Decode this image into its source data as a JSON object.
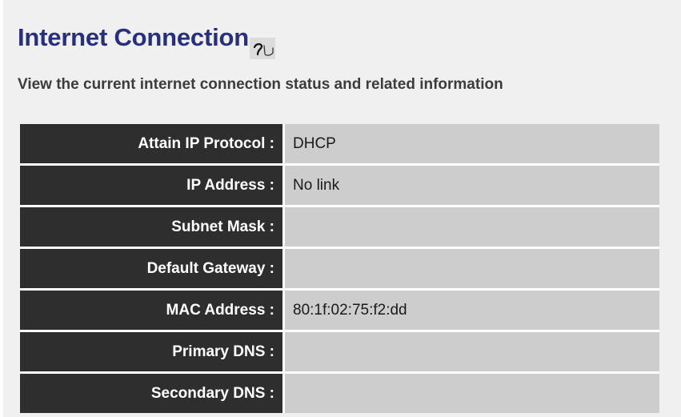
{
  "page": {
    "title": "Internet Connection",
    "description": "View the current internet connection status and related information",
    "help_icon": "help-icon"
  },
  "status_rows": [
    {
      "label": "Attain IP Protocol :",
      "value": "DHCP"
    },
    {
      "label": "IP Address :",
      "value": "No link"
    },
    {
      "label": "Subnet Mask :",
      "value": ""
    },
    {
      "label": "Default Gateway :",
      "value": ""
    },
    {
      "label": "MAC Address :",
      "value": "80:1f:02:75:f2:dd"
    },
    {
      "label": "Primary DNS :",
      "value": ""
    },
    {
      "label": "Secondary DNS :",
      "value": ""
    }
  ],
  "colors": {
    "title": "#27307e",
    "label_background": "#2e2e2e",
    "value_background": "#cdcdcd",
    "page_background": "#f0f0f0"
  }
}
